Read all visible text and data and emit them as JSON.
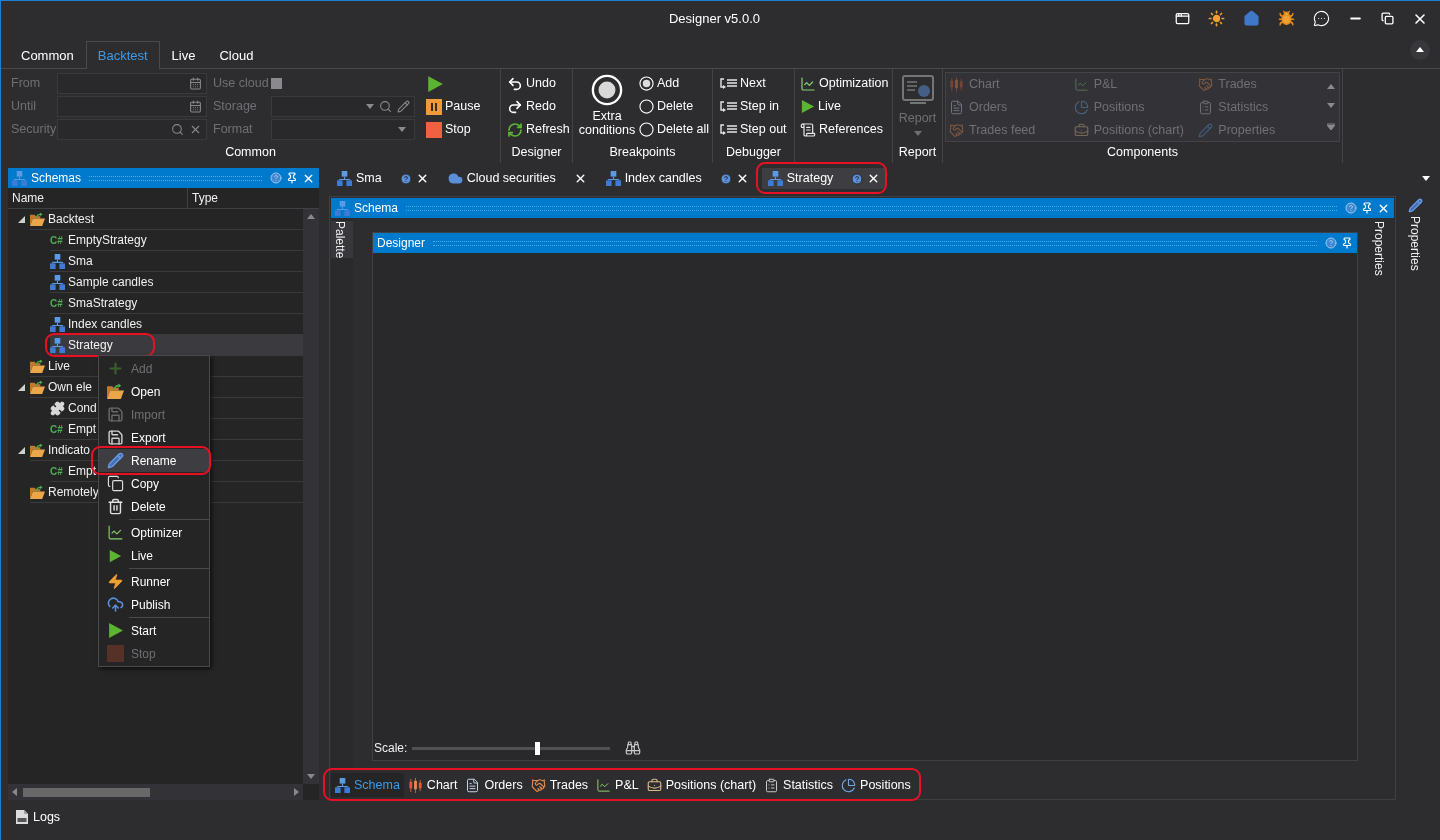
{
  "window": {
    "title": "Designer v5.0.0"
  },
  "ribbon": {
    "tabs": [
      {
        "label": "Common",
        "selected": false
      },
      {
        "label": "Backtest",
        "selected": true
      },
      {
        "label": "Live",
        "selected": false
      },
      {
        "label": "Cloud",
        "selected": false
      }
    ],
    "common": {
      "label": "Common",
      "fields": [
        {
          "label": "From",
          "kind": "date",
          "disabled": true
        },
        {
          "label": "Until",
          "kind": "date",
          "disabled": true
        },
        {
          "label": "Security",
          "kind": "search",
          "disabled": true
        }
      ],
      "options": [
        {
          "label": "Use cloud",
          "kind": "checkbox",
          "checked": false,
          "disabled": true
        },
        {
          "label": "Storage",
          "kind": "storage",
          "disabled": true
        },
        {
          "label": "Format",
          "kind": "dropdown",
          "disabled": true
        }
      ],
      "actions": [
        {
          "kind": "play"
        },
        {
          "label": "Pause",
          "kind": "pause"
        },
        {
          "label": "Stop",
          "kind": "stop"
        }
      ]
    },
    "designer": {
      "label": "Designer",
      "actions": [
        {
          "label": "Undo",
          "kind": "undo"
        },
        {
          "label": "Redo",
          "kind": "redo"
        },
        {
          "label": "Refresh",
          "kind": "refresh"
        }
      ]
    },
    "breakpoints": {
      "label": "Breakpoints",
      "big_button": "Extra conditions",
      "radios": [
        {
          "label": "Add",
          "selected": true
        },
        {
          "label": "Delete",
          "selected": false
        },
        {
          "label": "Delete all",
          "selected": false
        }
      ]
    },
    "debugger": {
      "label": "Debugger",
      "actions": [
        {
          "label": "Next",
          "kind": "step"
        },
        {
          "label": "Step in",
          "kind": "step"
        },
        {
          "label": "Step out",
          "kind": "step"
        }
      ]
    },
    "launch": {
      "actions": [
        {
          "label": "Optimization",
          "kind": "optimization"
        },
        {
          "label": "Live",
          "kind": "live"
        },
        {
          "label": "References",
          "kind": "references"
        }
      ]
    },
    "report": {
      "label": "Report",
      "button": {
        "label": "Report",
        "disabled": true
      }
    },
    "components": {
      "label": "Components",
      "items": [
        {
          "label": "Chart",
          "kind": "chart",
          "disabled": true
        },
        {
          "label": "P&L",
          "kind": "pnl",
          "disabled": true
        },
        {
          "label": "Trades",
          "kind": "trades",
          "disabled": true
        },
        {
          "label": "Orders",
          "kind": "orders",
          "disabled": true
        },
        {
          "label": "Positions",
          "kind": "positions",
          "disabled": true
        },
        {
          "label": "Statistics",
          "kind": "statistics",
          "disabled": true
        },
        {
          "label": "Trades feed",
          "kind": "trades",
          "disabled": true
        },
        {
          "label": "Positions (chart)",
          "kind": "positions_chart",
          "disabled": true
        },
        {
          "label": "Properties",
          "kind": "properties",
          "disabled": true
        }
      ]
    }
  },
  "schemas_panel": {
    "title": "Schemas",
    "columns": [
      "Name",
      "Type"
    ],
    "tree": [
      {
        "label": "Backtest",
        "kind": "folder",
        "expanded": true,
        "selected": false,
        "children": [
          {
            "label": "EmptyStrategy",
            "kind": "code",
            "icon_text": "C#",
            "selected": false
          },
          {
            "label": "Sma",
            "kind": "schema",
            "selected": false
          },
          {
            "label": "Sample candles",
            "kind": "schema",
            "selected": false
          },
          {
            "label": "SmaStrategy",
            "kind": "code",
            "icon_text": "C#",
            "selected": false
          },
          {
            "label": "Index candles",
            "kind": "schema",
            "selected": false
          },
          {
            "label": "Strategy",
            "kind": "schema",
            "selected": true,
            "highlighted": true
          }
        ]
      },
      {
        "label": "Live",
        "kind": "folder",
        "selected": false
      },
      {
        "label": "Own ele",
        "kind": "folder",
        "expanded": true,
        "selected": false,
        "children": [
          {
            "label": "Cond",
            "kind": "component",
            "selected": false
          },
          {
            "label": "Empt",
            "kind": "code",
            "icon_text": "C#",
            "selected": false
          }
        ]
      },
      {
        "label": "Indicato",
        "kind": "folder",
        "expanded": true,
        "selected": false,
        "children": [
          {
            "label": "Empt",
            "kind": "code",
            "icon_text": "C#",
            "selected": false
          }
        ]
      },
      {
        "label": "Remotely",
        "kind": "folder",
        "selected": false
      }
    ]
  },
  "context_menu": {
    "groups": [
      {
        "items": [
          {
            "label": "Add",
            "kind": "add",
            "disabled": true,
            "selected": false
          },
          {
            "label": "Open",
            "kind": "open",
            "disabled": false,
            "selected": false
          },
          {
            "label": "Import",
            "kind": "import",
            "disabled": true,
            "selected": false
          },
          {
            "label": "Export",
            "kind": "export",
            "disabled": false,
            "selected": false
          },
          {
            "label": "Rename",
            "kind": "rename",
            "disabled": false,
            "selected": true,
            "highlighted": true
          },
          {
            "label": "Copy",
            "kind": "copy",
            "disabled": false,
            "selected": false
          },
          {
            "label": "Delete",
            "kind": "delete",
            "disabled": false,
            "selected": false
          }
        ]
      },
      {
        "items": [
          {
            "label": "Optimizer",
            "kind": "optimizer",
            "disabled": false,
            "selected": false
          },
          {
            "label": "Live",
            "kind": "live",
            "disabled": false,
            "selected": false
          }
        ]
      },
      {
        "items": [
          {
            "label": "Runner",
            "kind": "runner",
            "disabled": false,
            "selected": false
          },
          {
            "label": "Publish",
            "kind": "publish",
            "disabled": false,
            "selected": false
          }
        ]
      },
      {
        "items": [
          {
            "label": "Start",
            "kind": "start",
            "disabled": false,
            "selected": false
          },
          {
            "label": "Stop",
            "kind": "stop",
            "disabled": true,
            "selected": false
          }
        ]
      }
    ]
  },
  "document_tabs": [
    {
      "label": "Sma",
      "kind": "schema",
      "help": true,
      "selected": false
    },
    {
      "label": "Cloud securities",
      "kind": "cloud",
      "help": false,
      "selected": false
    },
    {
      "label": "Index candles",
      "kind": "schema",
      "help": true,
      "selected": false
    },
    {
      "label": "Strategy",
      "kind": "schema",
      "help": true,
      "selected": true,
      "highlighted": true
    }
  ],
  "schema_panel": {
    "title": "Schema",
    "palette": "Palette",
    "properties": "Properties",
    "designer": {
      "title": "Designer",
      "scale": {
        "label": "Scale:",
        "level": 0.63
      }
    },
    "bottom_tabs": {
      "highlighted": true,
      "tabs": [
        {
          "label": "Schema",
          "kind": "schema",
          "selected": true
        },
        {
          "label": "Chart",
          "kind": "chart",
          "selected": false
        },
        {
          "label": "Orders",
          "kind": "orders",
          "selected": false
        },
        {
          "label": "Trades",
          "kind": "trades",
          "selected": false
        },
        {
          "label": "P&L",
          "kind": "pnl",
          "selected": false
        },
        {
          "label": "Positions (chart)",
          "kind": "positions_chart",
          "selected": false
        },
        {
          "label": "Statistics",
          "kind": "statistics",
          "selected": false
        },
        {
          "label": "Positions",
          "kind": "positions",
          "selected": false
        }
      ]
    }
  },
  "side_panel": {
    "title": "Properties"
  },
  "logs": {
    "label": "Logs"
  }
}
